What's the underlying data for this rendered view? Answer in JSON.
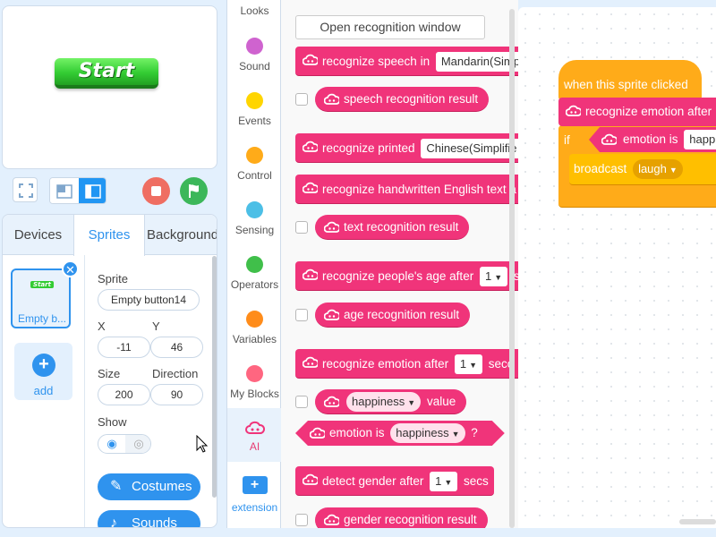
{
  "stage": {
    "start_button_label": "Start"
  },
  "tabs": {
    "devices": "Devices",
    "sprites": "Sprites",
    "backgrounds": "Background"
  },
  "sprite_list": {
    "thumb_name": "Empty b...",
    "thumb_mini_label": "Start",
    "add_label": "add"
  },
  "sprite_props": {
    "sprite_label": "Sprite",
    "sprite_name": "Empty button14",
    "x_label": "X",
    "x_value": "-11",
    "y_label": "Y",
    "y_value": "46",
    "size_label": "Size",
    "size_value": "200",
    "direction_label": "Direction",
    "direction_value": "90",
    "show_label": "Show",
    "costumes_label": "Costumes",
    "sounds_label": "Sounds"
  },
  "categories": [
    {
      "label": "Looks",
      "color": "#9966ff"
    },
    {
      "label": "Sound",
      "color": "#cf63cf"
    },
    {
      "label": "Events",
      "color": "#ffd500"
    },
    {
      "label": "Control",
      "color": "#ffab19"
    },
    {
      "label": "Sensing",
      "color": "#4cbfe6"
    },
    {
      "label": "Operators",
      "color": "#40bf4a"
    },
    {
      "label": "Variables",
      "color": "#ff8c1a"
    },
    {
      "label": "My Blocks",
      "color": "#ff6680"
    },
    {
      "label": "AI",
      "color": "#f0347a"
    },
    {
      "label": "extension",
      "color": "#2f93ee"
    }
  ],
  "palette": {
    "open_window": "Open recognition window",
    "speech": {
      "text": "recognize speech in",
      "lang": "Mandarin(Simp"
    },
    "speech_result": "speech recognition result",
    "printed": {
      "text": "recognize printed",
      "lang": "Chinese(Simplifie"
    },
    "handwritten": "recognize handwritten English text a",
    "text_result": "text recognition result",
    "age": {
      "text": "recognize people's age after",
      "secs": "1",
      "tail": "s"
    },
    "age_result": "age recognition result",
    "emotion": {
      "text": "recognize emotion after",
      "secs": "1",
      "tail": "seco"
    },
    "happiness_value": {
      "option": "happiness",
      "tail": "value"
    },
    "emotion_is": {
      "text": "emotion is",
      "option": "happiness",
      "tail": "?"
    },
    "gender": {
      "text": "detect gender after",
      "secs": "1",
      "tail": "secs"
    },
    "gender_result": "gender recognition result"
  },
  "script": {
    "hat": "when this sprite clicked",
    "emotion_after": "recognize emotion after",
    "if_label": "if",
    "cond_text": "emotion is",
    "cond_option": "happ",
    "broadcast_label": "broadcast",
    "broadcast_option": "laugh"
  },
  "colors": {
    "ai_block": "#f0347a",
    "events_block": "#ffab19",
    "accent": "#2f93ee"
  }
}
